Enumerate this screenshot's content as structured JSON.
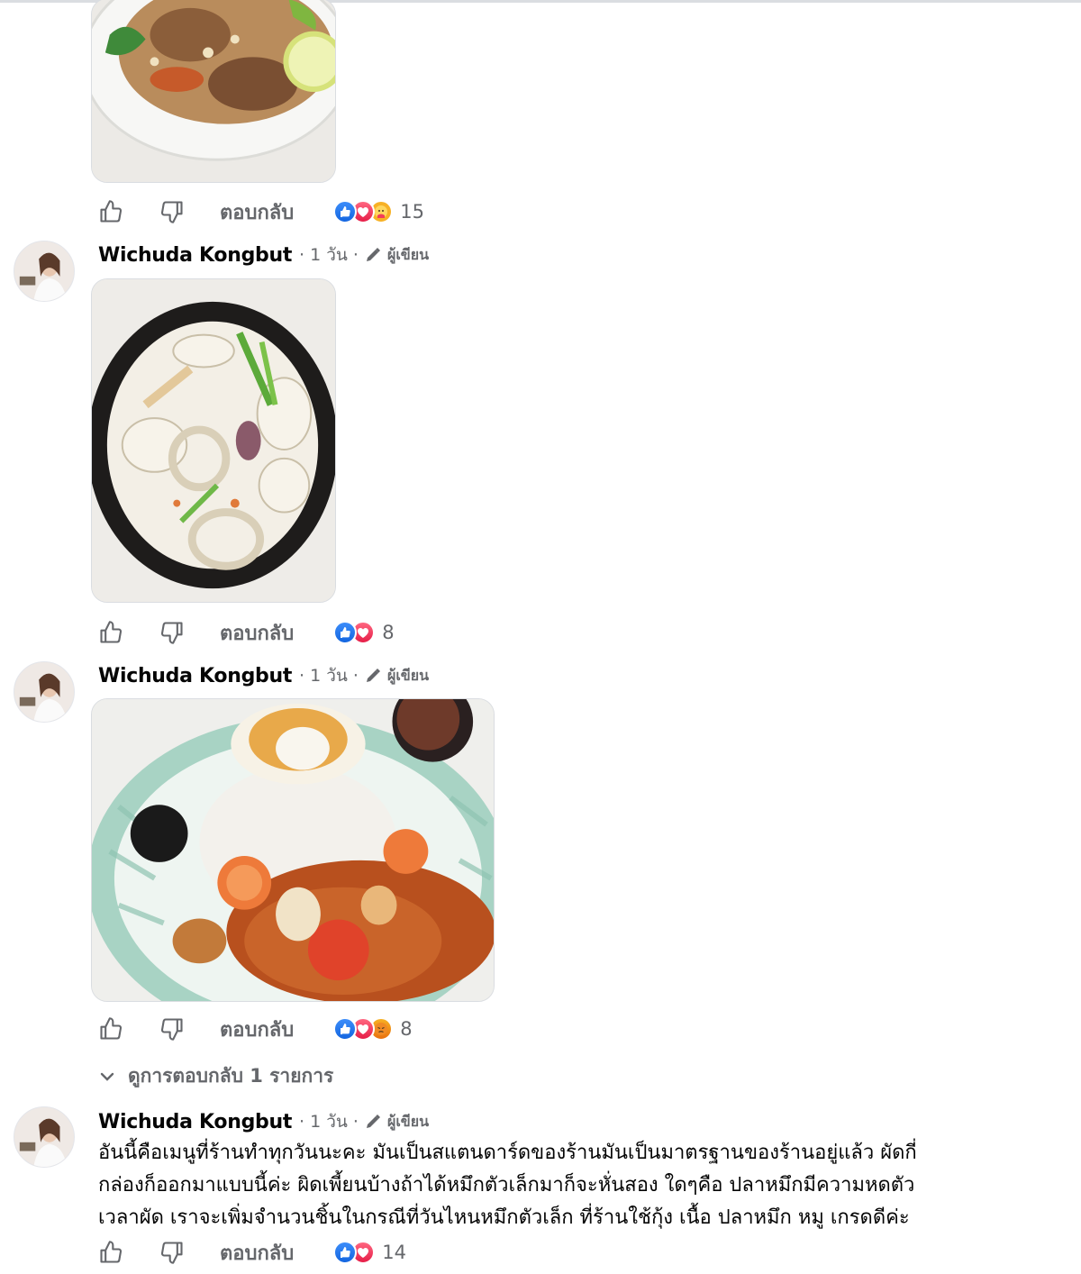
{
  "comments": [
    {
      "has_header": false,
      "photo_desc": "fried-rice",
      "reply_label": "ตอบกลับ",
      "reactions": [
        "like",
        "love",
        "care"
      ],
      "reaction_count": "15"
    },
    {
      "has_header": true,
      "author": "Wichuda Kongbut",
      "dot": "·",
      "time": "1 วัน",
      "dot2": "·",
      "author_badge": "ผู้เขียน",
      "photo_desc": "squid-bowl",
      "reply_label": "ตอบกลับ",
      "reactions": [
        "like",
        "love"
      ],
      "reaction_count": "8"
    },
    {
      "has_header": true,
      "author": "Wichuda Kongbut",
      "dot": "·",
      "time": "1 วัน",
      "dot2": "·",
      "author_badge": "ผู้เขียน",
      "photo_desc": "rice-plate",
      "reply_label": "ตอบกลับ",
      "reactions": [
        "like",
        "love",
        "angry"
      ],
      "reaction_count": "8",
      "view_replies": "ดูการตอบกลับ 1 รายการ"
    },
    {
      "has_header": true,
      "author": "Wichuda Kongbut",
      "dot": "·",
      "time": "1 วัน",
      "dot2": "·",
      "author_badge": "ผู้เขียน",
      "text_lines": [
        "อันนี้คือเมนูที่ร้านทำทุกวันนะคะ มันเป็นสแตนดาร์ดของร้านมันเป็นมาตรฐานของร้านอยู่แล้ว ผัดกี่",
        "กล่องก็ออกมาแบบนี้ค่ะ ผิดเพี้ยนบ้างถ้าได้หมึกตัวเล็กมาก็จะหั่นสอง ใดๆคือ ปลาหมึกมีความหดตัว",
        "เวลาผัด เราจะเพิ่มจำนวนชิ้นในกรณีที่วันไหนหมึกตัวเล็ก ที่ร้านใช้กุ้ง เนื้อ ปลาหมึก หมู เกรดดีค่ะ"
      ],
      "reply_label": "ตอบกลับ",
      "reactions": [
        "like",
        "love"
      ],
      "reaction_count": "14"
    }
  ],
  "colors": {
    "text_primary": "#050505",
    "text_secondary": "#65676b",
    "like_blue": "#1877f2",
    "love_red": "#f33e58",
    "care_yellow": "#f7b125"
  },
  "icons": [
    "thumbs-up-icon",
    "thumbs-down-icon",
    "pencil-icon",
    "chevron-down-icon",
    "like-reaction-icon",
    "love-reaction-icon",
    "care-reaction-icon",
    "angry-reaction-icon"
  ]
}
